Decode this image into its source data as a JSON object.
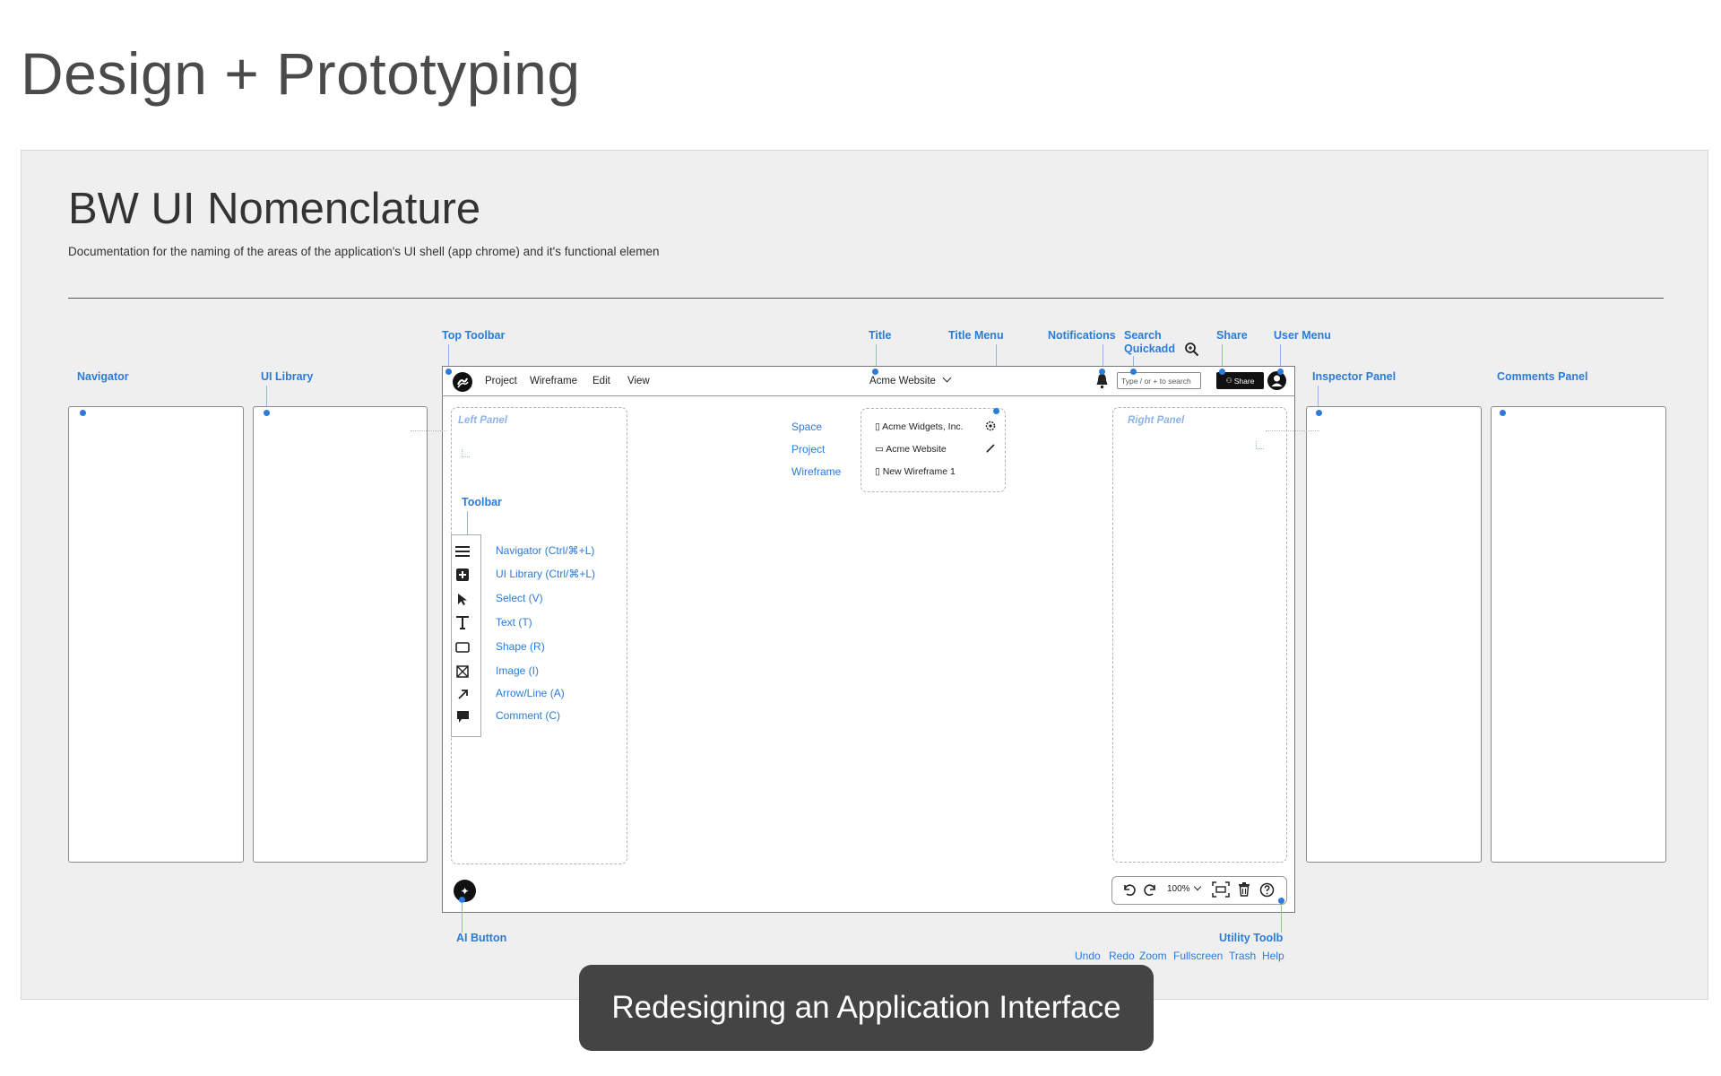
{
  "page": {
    "title": "Design + Prototyping"
  },
  "doc": {
    "title": "BW UI Nomenclature",
    "description": "Documentation for the naming of the areas of the application's UI shell (app chrome) and it's functional elemen"
  },
  "callouts": {
    "navigator": "Navigator",
    "ui_library": "UI Library",
    "top_toolbar": "Top Toolbar",
    "title": "Title",
    "title_menu": "Title Menu",
    "notifications": "Notifications",
    "search": "Search",
    "quickadd": "Quickadd",
    "share": "Share",
    "user_menu": "User Menu",
    "inspector_panel": "Inspector Panel",
    "comments_panel": "Comments Panel",
    "toolbar": "Toolbar",
    "ai_button": "AI Button",
    "utility_toolbar": "Utility Toolb"
  },
  "app": {
    "menu": [
      "Project",
      "Wireframe",
      "Edit",
      "View"
    ],
    "title": "Acme Website",
    "search_placeholder": "Type / or + to search",
    "share_label": "Share",
    "left_panel": "Left Panel",
    "right_panel": "Right Panel",
    "breadcrumb_labels": [
      "Space",
      "Project",
      "Wireframe"
    ],
    "breadcrumb_values": [
      "Acme Widgets, Inc.",
      "Acme Website",
      "New Wireframe 1"
    ],
    "tools": [
      {
        "icon": "hamburger-icon",
        "label": "Navigator (Ctrl/⌘+L)"
      },
      {
        "icon": "plus-box-icon",
        "label": "UI Library (Ctrl/⌘+L)"
      },
      {
        "icon": "pointer-icon",
        "label": "Select (V)"
      },
      {
        "icon": "text-icon",
        "label": "Text (T)"
      },
      {
        "icon": "rectangle-icon",
        "label": "Shape (R)"
      },
      {
        "icon": "image-icon",
        "label": "Image (I)"
      },
      {
        "icon": "arrow-icon",
        "label": "Arrow/Line (A)"
      },
      {
        "icon": "comment-icon",
        "label": "Comment (C)"
      }
    ],
    "zoom": "100%",
    "utility_labels": [
      "Undo",
      "Redo",
      "Zoom",
      "Fullscreen",
      "Trash",
      "Help"
    ]
  },
  "caption": "Redesigning an Application Interface",
  "colors": {
    "accent": "#2b7bd8",
    "board": "#efefef",
    "caption_bg": "#444444"
  }
}
